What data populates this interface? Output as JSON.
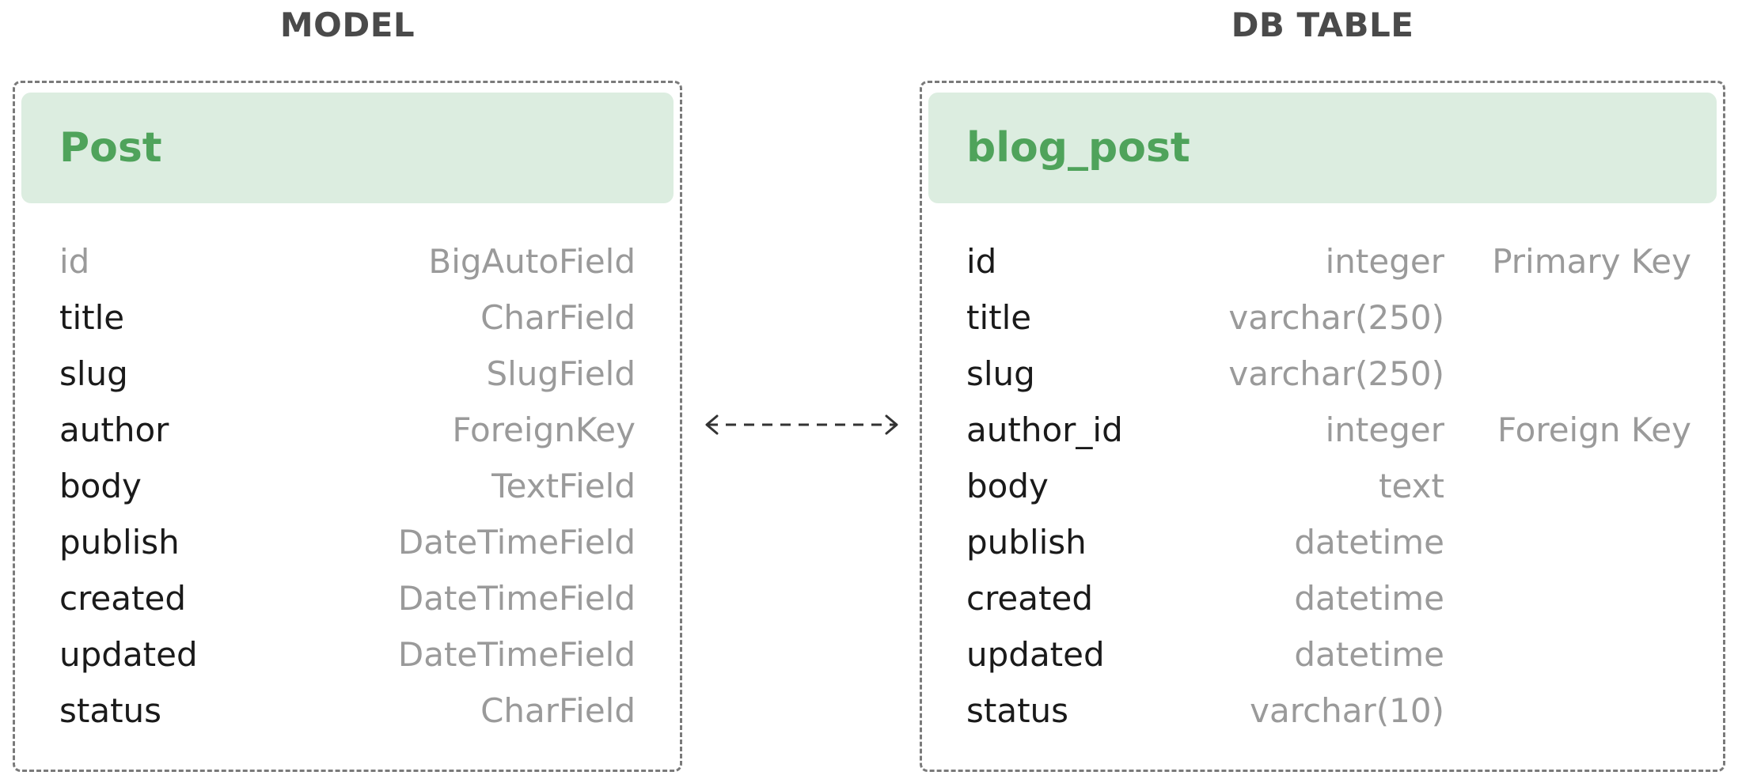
{
  "model": {
    "heading": "MODEL",
    "name": "Post",
    "fields": [
      {
        "name": "id",
        "type": "BigAutoField",
        "muted": true
      },
      {
        "name": "title",
        "type": "CharField"
      },
      {
        "name": "slug",
        "type": "SlugField"
      },
      {
        "name": "author",
        "type": "ForeignKey"
      },
      {
        "name": "body",
        "type": "TextField"
      },
      {
        "name": "publish",
        "type": "DateTimeField"
      },
      {
        "name": "created",
        "type": "DateTimeField"
      },
      {
        "name": "updated",
        "type": "DateTimeField"
      },
      {
        "name": "status",
        "type": "CharField"
      }
    ]
  },
  "db_table": {
    "heading": "DB TABLE",
    "name": "blog_post",
    "columns": [
      {
        "name": "id",
        "type": "integer",
        "key": "Primary Key"
      },
      {
        "name": "title",
        "type": "varchar(250)",
        "key": ""
      },
      {
        "name": "slug",
        "type": "varchar(250)",
        "key": ""
      },
      {
        "name": "author_id",
        "type": "integer",
        "key": "Foreign Key"
      },
      {
        "name": "body",
        "type": "text",
        "key": ""
      },
      {
        "name": "publish",
        "type": "datetime",
        "key": ""
      },
      {
        "name": "created",
        "type": "datetime",
        "key": ""
      },
      {
        "name": "updated",
        "type": "datetime",
        "key": ""
      },
      {
        "name": "status",
        "type": "varchar(10)",
        "key": ""
      }
    ]
  },
  "colors": {
    "header_bg": "#dcede0",
    "header_text": "#4fa35b",
    "muted_text": "#9a9a9a",
    "border": "#7a7a7a"
  }
}
